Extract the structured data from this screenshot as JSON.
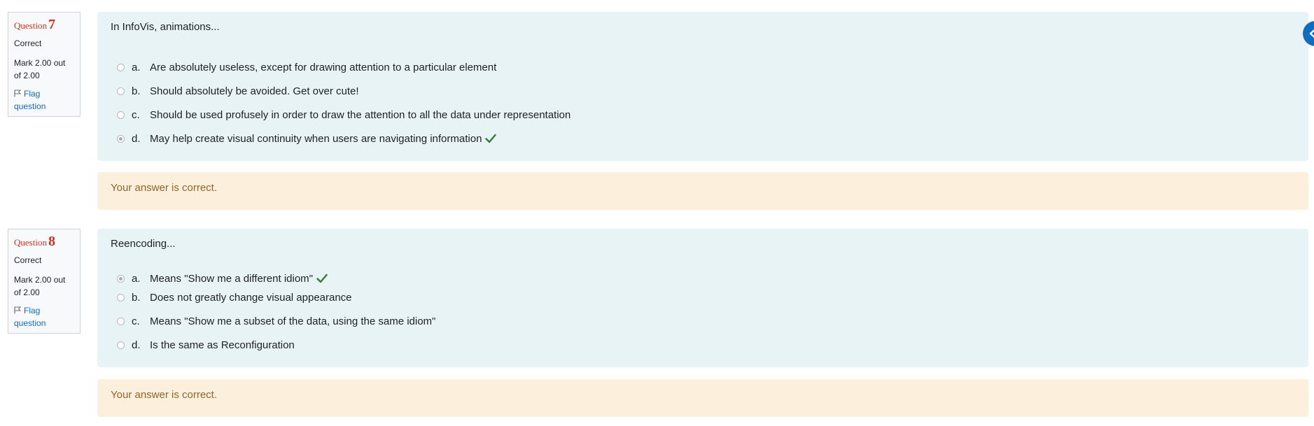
{
  "questions": [
    {
      "label": "Question",
      "number": "7",
      "state": "Correct",
      "grade": "Mark 2.00 out of 2.00",
      "flag_label": "Flag question",
      "text": "In InfoVis, animations...",
      "options": [
        {
          "letter": "a.",
          "text": "Are absolutely useless, except for drawing attention to a particular element",
          "selected": false
        },
        {
          "letter": "b.",
          "text": "Should absolutely be avoided. Get over cute!",
          "selected": false
        },
        {
          "letter": "c.",
          "text": "Should be used profusely in order to draw the attention to all the data under representation",
          "selected": false
        },
        {
          "letter": "d.",
          "text": "May help create visual continuity when users are navigating information",
          "selected": true
        }
      ],
      "feedback": "Your answer is correct."
    },
    {
      "label": "Question",
      "number": "8",
      "state": "Correct",
      "grade": "Mark 2.00 out of 2.00",
      "flag_label": "Flag question",
      "text": "Reencoding...",
      "options": [
        {
          "letter": "a.",
          "text": "Means \"Show me a different idiom\"",
          "selected": true
        },
        {
          "letter": "b.",
          "text": "Does not greatly change visual appearance",
          "selected": false
        },
        {
          "letter": "c.",
          "text": "Means \"Show me a subset of the data, using the same idiom\"",
          "selected": false
        },
        {
          "letter": "d.",
          "text": "Is the same as Reconfiguration",
          "selected": false
        }
      ],
      "feedback": "Your answer is correct."
    }
  ],
  "icons": {
    "flag": "flag-icon",
    "correct": "check-icon",
    "drawer": "chevron-left-icon"
  },
  "colors": {
    "question_number": "#ca3120",
    "link": "#0f6cbf",
    "formulation_bg": "#e7f3f5",
    "feedback_bg": "#fcefdc",
    "feedback_text": "#8e662e",
    "correct_check": "#357a32"
  }
}
